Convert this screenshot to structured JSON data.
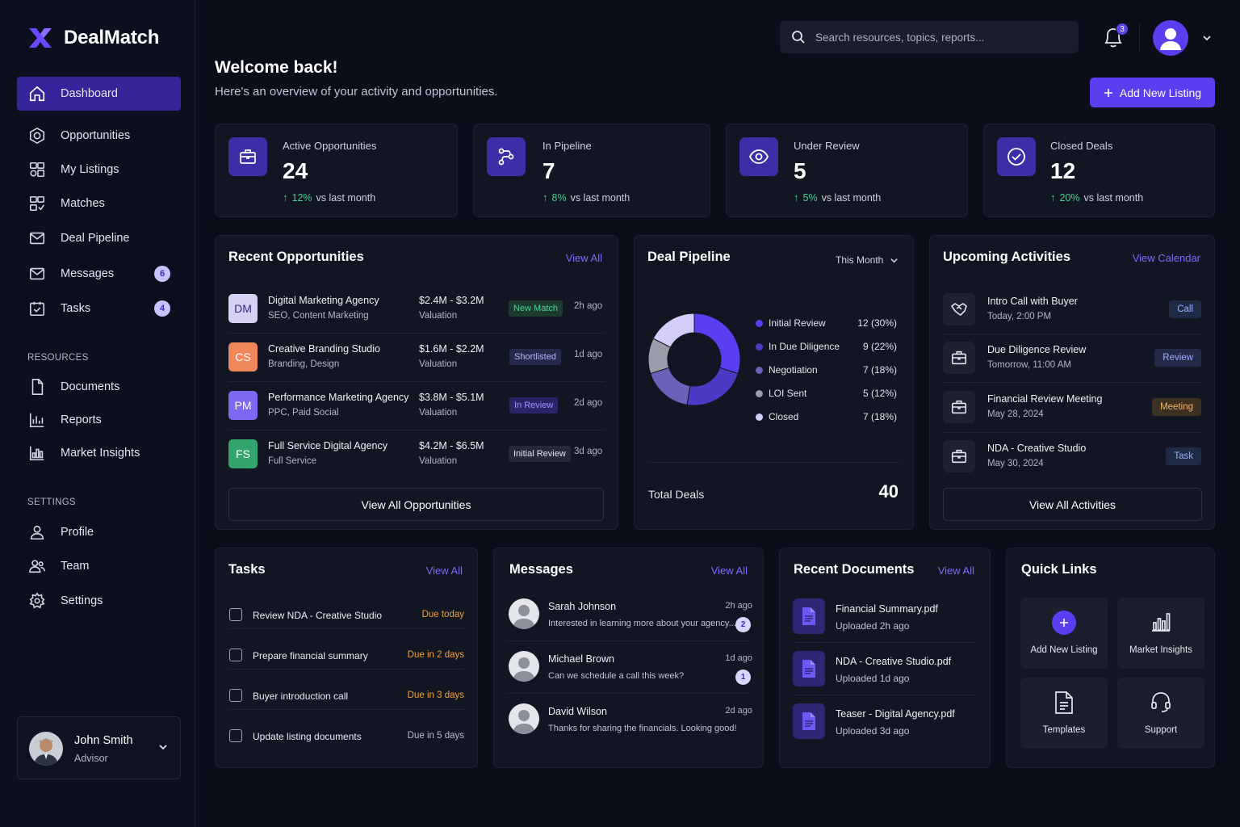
{
  "app": {
    "name": "DealMatch"
  },
  "sidebar": {
    "items": [
      {
        "label": "Dashboard"
      },
      {
        "label": "Opportunities"
      },
      {
        "label": "My Listings"
      },
      {
        "label": "Matches"
      },
      {
        "label": "Deal Pipeline"
      },
      {
        "label": "Messages",
        "badge": "6"
      },
      {
        "label": "Tasks",
        "badge": "4"
      }
    ],
    "resources_heading": "RESOURCES",
    "resources": [
      {
        "label": "Documents"
      },
      {
        "label": "Reports"
      },
      {
        "label": "Market Insights"
      }
    ],
    "settings_heading": "SETTINGS",
    "settings": [
      {
        "label": "Profile"
      },
      {
        "label": "Team"
      },
      {
        "label": "Settings"
      }
    ],
    "user": {
      "name": "John Smith",
      "role": "Advisor"
    }
  },
  "header": {
    "search_placeholder": "Search resources, topics, reports...",
    "notifications_count": "3"
  },
  "welcome": {
    "title": "Welcome back!",
    "subtitle": "Here's an overview of your activity and opportunities.",
    "add_button": "Add New Listing"
  },
  "stats": [
    {
      "label": "Active Opportunities",
      "value": "24",
      "change": "12%",
      "suffix": "vs last month"
    },
    {
      "label": "In Pipeline",
      "value": "7",
      "change": "8%",
      "suffix": "vs last month"
    },
    {
      "label": "Under Review",
      "value": "5",
      "change": "5%",
      "suffix": "vs last month"
    },
    {
      "label": "Closed Deals",
      "value": "12",
      "change": "20%",
      "suffix": "vs last month"
    }
  ],
  "recent_opportunities": {
    "title": "Recent Opportunities",
    "link": "View All",
    "rows": [
      {
        "initials": "DM",
        "name": "Digital Marketing Agency",
        "tags": "SEO, Content Marketing",
        "value": "$2.4M - $3.2M",
        "value_label": "Valuation",
        "status": "New Match",
        "time": "2h ago"
      },
      {
        "initials": "CS",
        "name": "Creative Branding Studio",
        "tags": "Branding, Design",
        "value": "$1.6M - $2.2M",
        "value_label": "Valuation",
        "status": "Shortlisted",
        "time": "1d ago"
      },
      {
        "initials": "PM",
        "name": "Performance Marketing Agency",
        "tags": "PPC, Paid Social",
        "value": "$3.8M - $5.1M",
        "value_label": "Valuation",
        "status": "In Review",
        "time": "2d ago"
      },
      {
        "initials": "FS",
        "name": "Full Service Digital Agency",
        "tags": "Full Service",
        "value": "$4.2M - $6.5M",
        "value_label": "Valuation",
        "status": "Initial Review",
        "time": "3d ago"
      }
    ],
    "button": "View All Opportunities"
  },
  "deal_pipeline": {
    "title": "Deal Pipeline",
    "period": "This Month",
    "stages": [
      {
        "name": "Initial Review",
        "value": "12 (30%)",
        "count": 12,
        "color": "#5a3ef0"
      },
      {
        "name": "In Due Diligence",
        "value": "9 (22%)",
        "count": 9,
        "color": "#4b3bc4"
      },
      {
        "name": "Negotiation",
        "value": "7 (18%)",
        "count": 7,
        "color": "#6b61b8"
      },
      {
        "name": "LOI Sent",
        "value": "5 (12%)",
        "count": 5,
        "color": "#9c9ca8"
      },
      {
        "name": "Closed",
        "value": "7 (18%)",
        "count": 7,
        "color": "#d4cefa"
      }
    ],
    "total_label": "Total Deals",
    "total_value": "40"
  },
  "upcoming_activities": {
    "title": "Upcoming Activities",
    "link": "View Calendar",
    "rows": [
      {
        "icon": "handshake-icon",
        "title": "Intro Call with Buyer",
        "time": "Today, 2:00 PM",
        "tag": "Call"
      },
      {
        "icon": "briefcase-icon",
        "title": "Due Diligence Review",
        "time": "Tomorrow, 11:00 AM",
        "tag": "Review"
      },
      {
        "icon": "briefcase-icon",
        "title": "Financial Review Meeting",
        "time": "May 28, 2024",
        "tag": "Meeting"
      },
      {
        "icon": "briefcase-icon",
        "title": "NDA - Creative Studio",
        "time": "May 30, 2024",
        "tag": "Task"
      }
    ],
    "button": "View All Activities"
  },
  "tasks": {
    "title": "Tasks",
    "link": "View All",
    "rows": [
      {
        "label": "Review NDA - Creative Studio",
        "due": "Due today"
      },
      {
        "label": "Prepare financial summary",
        "due": "Due in 2 days"
      },
      {
        "label": "Buyer introduction call",
        "due": "Due in 3 days"
      },
      {
        "label": "Update listing documents",
        "due": "Due in 5 days"
      }
    ]
  },
  "messages": {
    "title": "Messages",
    "link": "View All",
    "rows": [
      {
        "name": "Sarah Johnson",
        "text": "Interested in learning more about your agency...",
        "time": "2h ago",
        "unread": "2"
      },
      {
        "name": "Michael Brown",
        "text": "Can we schedule a call this week?",
        "time": "1d ago",
        "unread": "1"
      },
      {
        "name": "David Wilson",
        "text": "Thanks for sharing the financials. Looking good!",
        "time": "2d ago",
        "unread": ""
      }
    ]
  },
  "documents": {
    "title": "Recent Documents",
    "link": "View All",
    "rows": [
      {
        "name": "Financial Summary.pdf",
        "time": "Uploaded 2h ago"
      },
      {
        "name": "NDA - Creative Studio.pdf",
        "time": "Uploaded 1d ago"
      },
      {
        "name": "Teaser - Digital Agency.pdf",
        "time": "Uploaded 3d ago"
      }
    ]
  },
  "quick_links": {
    "title": "Quick Links",
    "items": [
      {
        "label": "Add New Listing",
        "icon": "plus-circle-icon"
      },
      {
        "label": "Market Insights",
        "icon": "bar-chart-icon"
      },
      {
        "label": "Templates",
        "icon": "document-icon"
      },
      {
        "label": "Support",
        "icon": "headset-icon"
      }
    ]
  },
  "colors": {
    "accent": "#5a3ef0",
    "background": "#0b0d18",
    "card": "#121522",
    "positive": "#3fd394"
  }
}
